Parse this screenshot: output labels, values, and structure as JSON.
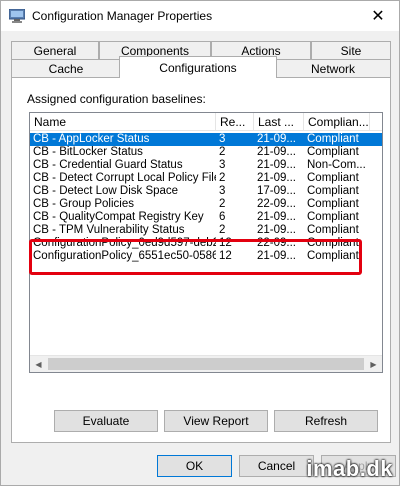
{
  "window": {
    "title": "Configuration Manager Properties",
    "close_glyph": "✕"
  },
  "tabs": {
    "row1": [
      "General",
      "Components",
      "Actions",
      "Site"
    ],
    "row2": [
      "Cache",
      "Configurations",
      "Network"
    ],
    "active": "Configurations"
  },
  "panel": {
    "label": "Assigned configuration baselines:",
    "columns": [
      "Name",
      "Re...",
      "Last ...",
      "Complian..."
    ],
    "rows": [
      {
        "name": "CB - AppLocker Status",
        "rev": "3",
        "last": "21-09...",
        "compliance": "Compliant",
        "selected": true
      },
      {
        "name": "CB - BitLocker Status",
        "rev": "2",
        "last": "21-09...",
        "compliance": "Compliant"
      },
      {
        "name": "CB - Credential Guard Status",
        "rev": "3",
        "last": "21-09...",
        "compliance": "Non-Com..."
      },
      {
        "name": "CB - Detect Corrupt Local Policy Files",
        "rev": "2",
        "last": "21-09...",
        "compliance": "Compliant"
      },
      {
        "name": "CB - Detect Low Disk Space",
        "rev": "3",
        "last": "17-09...",
        "compliance": "Compliant"
      },
      {
        "name": "CB - Group Policies",
        "rev": "2",
        "last": "22-09...",
        "compliance": "Compliant"
      },
      {
        "name": "CB - QualityCompat Registry Key",
        "rev": "6",
        "last": "21-09...",
        "compliance": "Compliant"
      },
      {
        "name": "CB - TPM Vulnerability Status",
        "rev": "2",
        "last": "21-09...",
        "compliance": "Compliant"
      },
      {
        "name": "ConfigurationPolicy_0ed9d597-deb2...",
        "rev": "12",
        "last": "22-09...",
        "compliance": "Compliant"
      },
      {
        "name": "ConfigurationPolicy_6551ec50-0586...",
        "rev": "12",
        "last": "21-09...",
        "compliance": "Compliant"
      }
    ],
    "buttons": {
      "evaluate": "Evaluate",
      "view_report": "View Report",
      "refresh": "Refresh"
    }
  },
  "footer": {
    "ok": "OK",
    "cancel": "Cancel",
    "apply": "Apply"
  },
  "watermark": "imab.dk",
  "colors": {
    "selection": "#0078d7",
    "highlight_border": "#e3000f"
  }
}
